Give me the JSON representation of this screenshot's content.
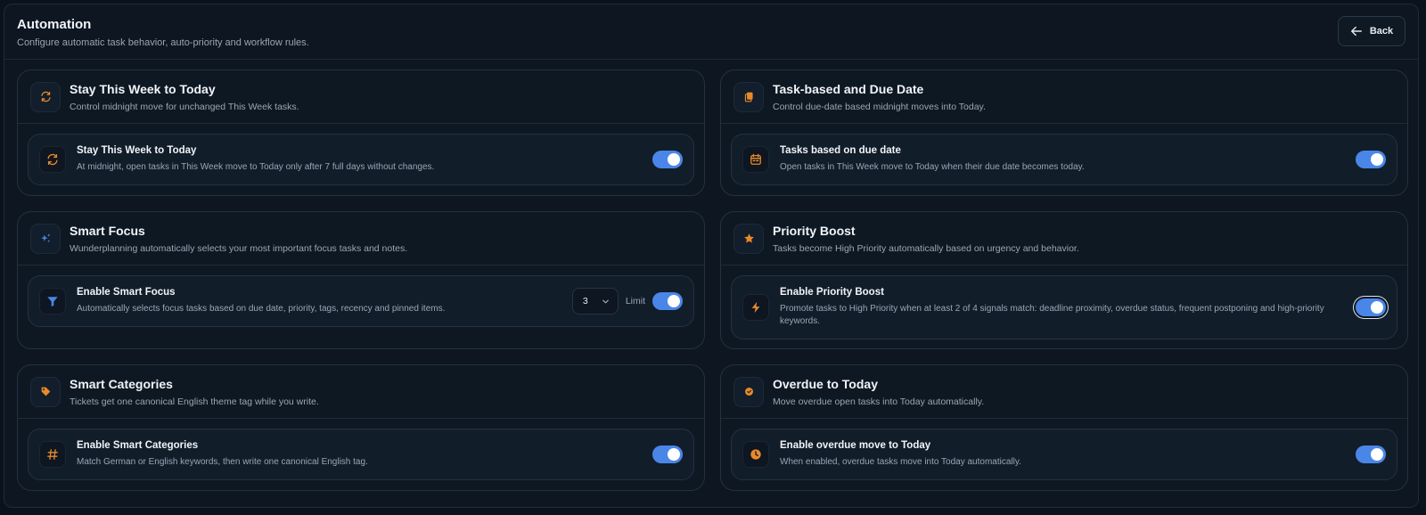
{
  "header": {
    "title": "Automation",
    "subtitle": "Configure automatic task behavior, auto-priority and workflow rules.",
    "back_label": "Back"
  },
  "colors": {
    "accent": "#4a86e8",
    "icon_orange": "#e8892b",
    "icon_blue": "#4a86e8"
  },
  "cards": [
    {
      "title": "Stay This Week to Today",
      "subtitle": "Control midnight move for unchanged This Week tasks.",
      "icon": "refresh-icon",
      "setting": {
        "title": "Stay This Week to Today",
        "description": "At midnight, open tasks in This Week move to Today only after 7 full days without changes.",
        "icon": "refresh-icon",
        "enabled": true
      }
    },
    {
      "title": "Task-based and Due Date",
      "subtitle": "Control due-date based midnight moves into Today.",
      "icon": "copy-icon",
      "setting": {
        "title": "Tasks based on due date",
        "description": "Open tasks in This Week move to Today when their due date becomes today.",
        "icon": "calendar-icon",
        "enabled": true
      }
    },
    {
      "title": "Smart Focus",
      "subtitle": "Wunderplanning automatically selects your most important focus tasks and notes.",
      "icon": "sparkles-icon",
      "setting": {
        "title": "Enable Smart Focus",
        "description": "Automatically selects focus tasks based on due date, priority, tags, recency and pinned items.",
        "icon": "filter-icon",
        "limit_value": "3",
        "limit_label": "Limit",
        "enabled": true
      }
    },
    {
      "title": "Priority Boost",
      "subtitle": "Tasks become High Priority automatically based on urgency and behavior.",
      "icon": "star-icon",
      "setting": {
        "title": "Enable Priority Boost",
        "description": "Promote tasks to High Priority when at least 2 of 4 signals match: deadline proximity, overdue status, frequent postponing and high-priority keywords.",
        "icon": "bolt-icon",
        "enabled": true
      }
    },
    {
      "title": "Smart Categories",
      "subtitle": "Tickets get one canonical English theme tag while you write.",
      "icon": "tag-icon",
      "setting": {
        "title": "Enable Smart Categories",
        "description": "Match German or English keywords, then write one canonical English tag.",
        "icon": "hash-icon",
        "enabled": true
      }
    },
    {
      "title": "Overdue to Today",
      "subtitle": "Move overdue open tasks into Today automatically.",
      "icon": "badge-icon",
      "setting": {
        "title": "Enable overdue move to Today",
        "description": "When enabled, overdue tasks move into Today automatically.",
        "icon": "clock-icon",
        "enabled": true
      }
    }
  ]
}
